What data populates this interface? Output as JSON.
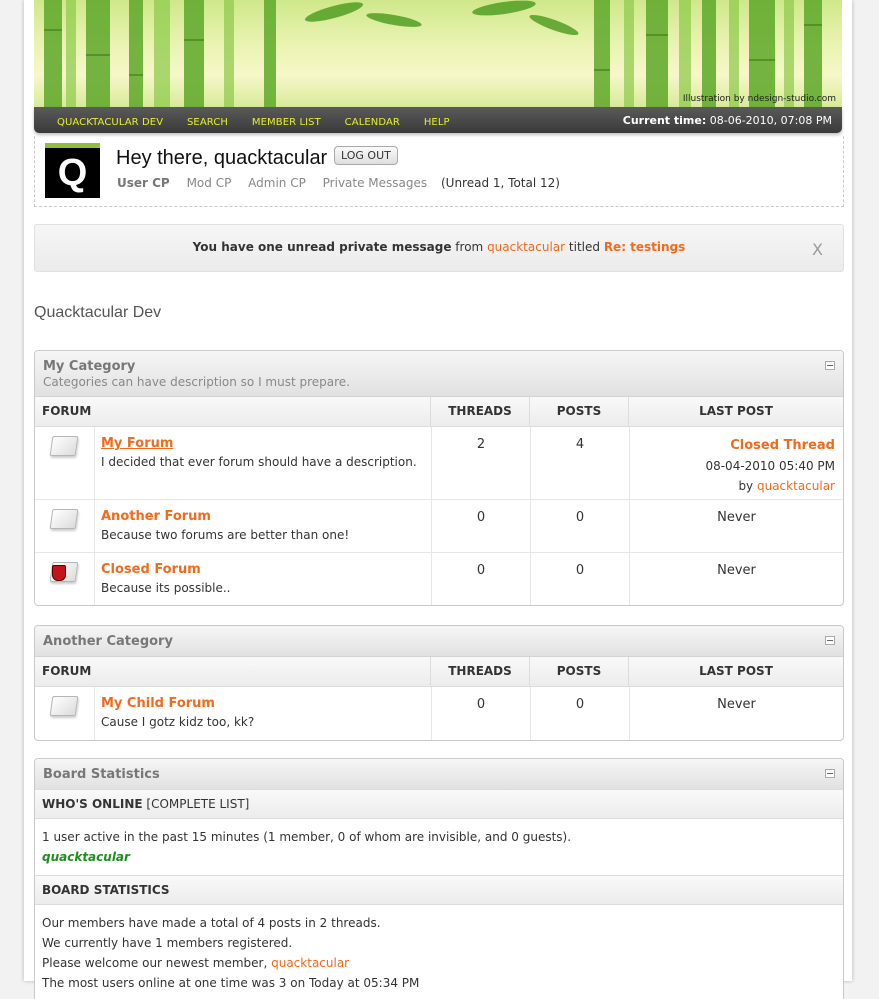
{
  "banner": {
    "credit": "Illustration by ndesign-studio.com"
  },
  "nav": {
    "links": [
      "QUACKTACULAR DEV",
      "SEARCH",
      "MEMBER LIST",
      "CALENDAR",
      "HELP"
    ],
    "time_label": "Current time:",
    "time_value": "08-06-2010, 07:08 PM"
  },
  "welcome": {
    "avatar_letter": "Q",
    "greeting": "Hey there, quacktacular",
    "logout": "LOG OUT",
    "links": [
      "User CP",
      "Mod CP",
      "Admin CP",
      "Private Messages"
    ],
    "counts": "(Unread 1, Total 12)"
  },
  "pm_notice": {
    "text1": "You have one unread private message",
    "text2": "from",
    "sender": "quacktacular",
    "text3": "titled",
    "title": "Re: testings",
    "close": "X"
  },
  "board_title": "Quacktacular Dev",
  "columns": {
    "forum": "FORUM",
    "threads": "THREADS",
    "posts": "POSTS",
    "last_post": "LAST POST"
  },
  "categories": [
    {
      "name": "My Category",
      "description": "Categories can have description so I must prepare.",
      "forums": [
        {
          "name": "My Forum",
          "description": "I decided that ever forum should have a description.",
          "threads": "2",
          "posts": "4",
          "last_title": "Closed Thread",
          "last_date": "08-04-2010 05:40 PM",
          "last_by": "by",
          "last_user": "quacktacular"
        },
        {
          "name": "Another Forum",
          "description": "Because two forums are better than one!",
          "threads": "0",
          "posts": "0",
          "last": "Never"
        },
        {
          "name": "Closed Forum",
          "description": "Because its possible..",
          "threads": "0",
          "posts": "0",
          "last": "Never"
        }
      ]
    },
    {
      "name": "Another Category",
      "forums": [
        {
          "name": "My Child Forum",
          "description": "Cause I gotz kidz too, kk?",
          "threads": "0",
          "posts": "0",
          "last": "Never"
        }
      ]
    }
  ],
  "stats": {
    "title": "Board Statistics",
    "whos_online": "WHO'S ONLINE",
    "complete_list": "[COMPLETE LIST]",
    "active_text": "1 user active in the past 15 minutes (1 member, 0 of whom are invisible, and 0 guests).",
    "online_user": "quacktacular",
    "board_stats_label": "BOARD STATISTICS",
    "line1": "Our members have made a total of 4 posts in 2 threads.",
    "line2": "We currently have 1 members registered.",
    "line3": "Please welcome our newest member,",
    "newest": "quacktacular",
    "line4": "The most users online at one time was 3 on Today at 05:34 PM"
  },
  "colors": {
    "accent": "#f26a1b",
    "nav_link": "#e6ef2c",
    "online_user": "#1e8f1e"
  },
  "icons": [
    "forum-read-icon",
    "forum-locked-icon",
    "collapse-icon"
  ]
}
